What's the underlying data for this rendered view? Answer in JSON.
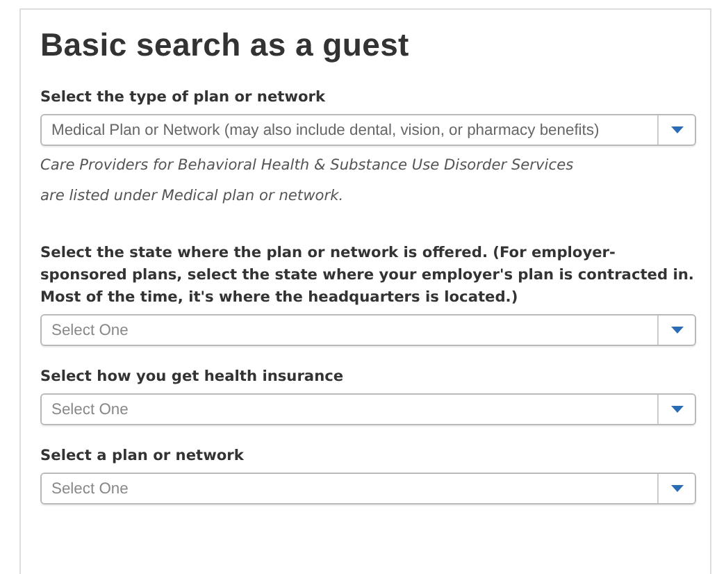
{
  "title": "Basic search as a guest",
  "fields": [
    {
      "label": "Select the type of plan or network",
      "value": "Medical Plan or Network (may also include dental, vision, or pharmacy benefits)",
      "note": "Care Providers for Behavioral Health & Substance Use Disorder Services are listed under Medical plan or network."
    },
    {
      "label": "Select the state where the plan or network is offered. (For employer-sponsored plans, select the state where your employer's plan is contracted in. Most of the time, it's where the headquarters is located.)",
      "placeholder": "Select One"
    },
    {
      "label": "Select how you get health insurance",
      "placeholder": "Select One"
    },
    {
      "label": "Select a plan or network",
      "placeholder": "Select One"
    }
  ]
}
